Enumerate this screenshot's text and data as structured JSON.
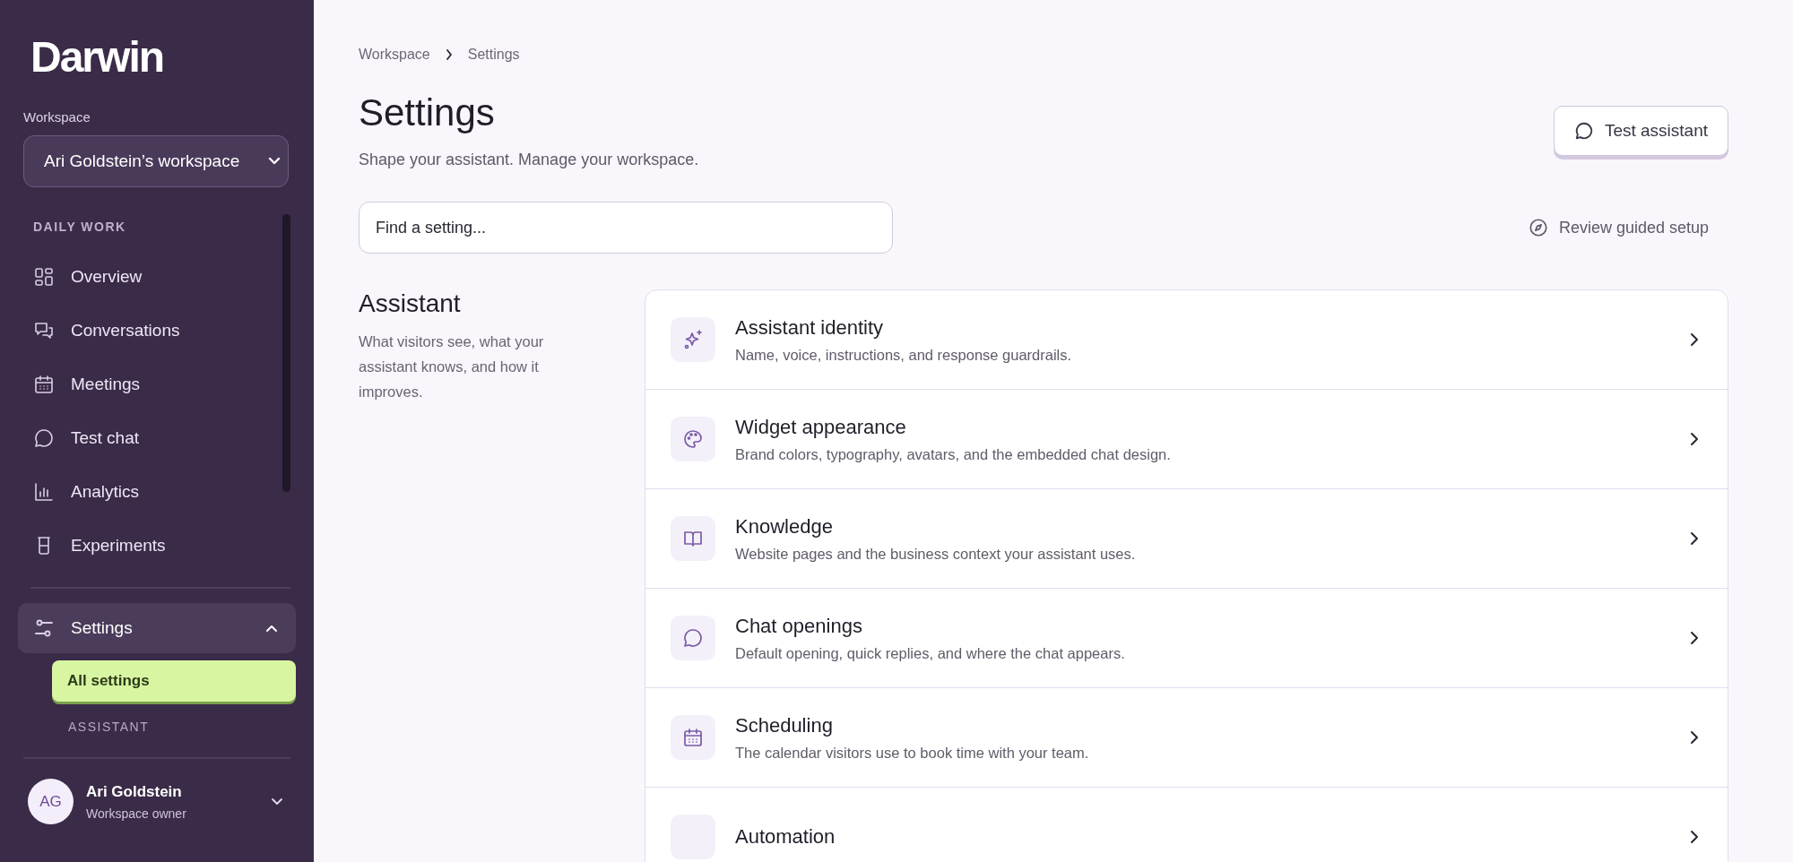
{
  "sidebar": {
    "logo": "Darwin",
    "workspace_label": "Workspace",
    "workspace_select": "Ari Goldstein’s workspace",
    "section_label": "DAILY WORK",
    "items": [
      {
        "label": "Overview",
        "kind": "grid",
        "selected": false
      },
      {
        "label": "Conversations",
        "kind": "chats",
        "selected": false
      },
      {
        "label": "Meetings",
        "kind": "calendar",
        "selected": false
      },
      {
        "label": "Test chat",
        "kind": "bubble",
        "selected": false
      },
      {
        "label": "Analytics",
        "kind": "bars",
        "selected": false
      },
      {
        "label": "Experiments",
        "kind": "beaker",
        "selected": false
      }
    ],
    "settings": {
      "label": "Settings",
      "expanded": true,
      "children": [
        {
          "kind": "link",
          "label": "All settings",
          "selected": true
        },
        {
          "kind": "heading",
          "label": "ASSISTANT"
        }
      ]
    },
    "user": {
      "initials": "AG",
      "name": "Ari Goldstein",
      "role": "Workspace owner"
    }
  },
  "breadcrumb": [
    "Workspace",
    "Settings"
  ],
  "header": {
    "title": "Settings",
    "subtitle": "Shape your assistant. Manage your workspace.",
    "button": "Test assistant"
  },
  "search": {
    "placeholder": "Find a setting..."
  },
  "guided_setup": "Review guided setup",
  "section": {
    "title": "Assistant",
    "description": "What visitors see, what your assistant knows, and how it improves.",
    "rows": [
      {
        "kind": "sparkle",
        "title": "Assistant identity",
        "description": "Name, voice, instructions, and response guardrails."
      },
      {
        "kind": "palette",
        "title": "Widget appearance",
        "description": "Brand colors, typography, avatars, and the embedded chat design."
      },
      {
        "kind": "book",
        "title": "Knowledge",
        "description": "Website pages and the business context your assistant uses."
      },
      {
        "kind": "bubble",
        "title": "Chat openings",
        "description": "Default opening, quick replies, and where the chat appears."
      },
      {
        "kind": "calendar",
        "title": "Scheduling",
        "description": "The calendar visitors use to book time with your team."
      },
      {
        "kind": "none",
        "title": "Automation"
      }
    ]
  }
}
